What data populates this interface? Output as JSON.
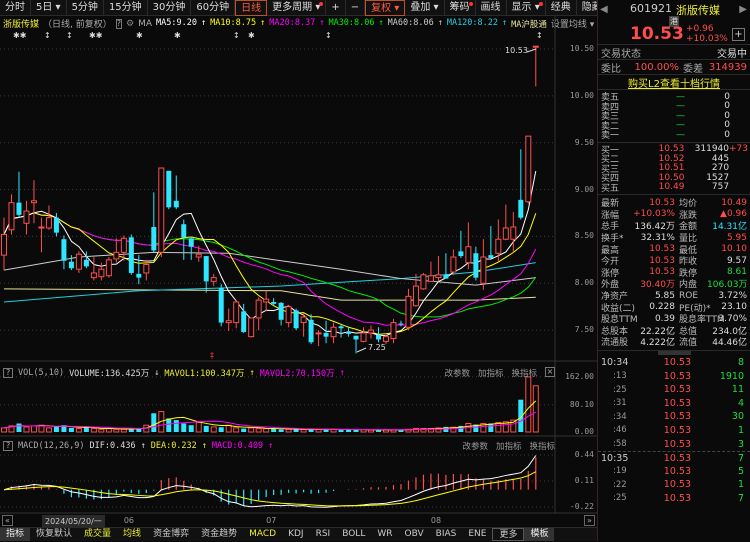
{
  "toolbar": {
    "items": [
      {
        "label": "分时"
      },
      {
        "label": "5日 ▾"
      },
      {
        "label": "5分钟"
      },
      {
        "label": "15分钟"
      },
      {
        "label": "30分钟"
      },
      {
        "label": "60分钟"
      },
      {
        "label": "日线",
        "active": true
      },
      {
        "label": "更多周期 ▾",
        "dot": true
      },
      {
        "label": "+"
      },
      {
        "label": "−"
      },
      {
        "label": "复权 ▾",
        "active": true
      },
      {
        "label": "叠加 ▾"
      },
      {
        "label": "筹码",
        "dot": true
      },
      {
        "label": "画线"
      },
      {
        "label": "显示 ▾",
        "dot": true
      },
      {
        "label": "经典"
      },
      {
        "label": "隐藏 ▸▸"
      },
      {
        "label": "⛶"
      }
    ]
  },
  "main": {
    "stock_name": "浙版传媒",
    "mode": "（日线, 前复权）",
    "help": "?",
    "ma_label": "MA",
    "ma": [
      {
        "label": "MA5:9.20",
        "color": "#ffffff"
      },
      {
        "label": "MA10:8.75",
        "color": "#ffff00"
      },
      {
        "label": "MA20:8.37",
        "color": "#ff00ff"
      },
      {
        "label": "MA30:8.06",
        "color": "#00ee00"
      },
      {
        "label": "MA60:8.06",
        "color": "#cccccc"
      },
      {
        "label": "MA120:8.22",
        "color": "#22d0e0"
      },
      {
        "label": "MA沪股通",
        "color": "#e8e0a0"
      }
    ],
    "ma_arrow": "↑",
    "ma_settings": "设置均线 ▾",
    "high_marker": "10.53",
    "low_marker": "7.25"
  },
  "chart_data": {
    "type": "candlestick",
    "price_axis": {
      "ticks": [
        "10.50",
        "10.00",
        "9.50",
        "9.00",
        "8.50",
        "8.00",
        "7.50"
      ],
      "range": [
        7.2,
        10.6
      ]
    },
    "x_ticks": [
      "06",
      "07",
      "08"
    ],
    "cursor_date": "2024/05/20/一",
    "ohlc": [
      [
        8.3,
        8.7,
        8.14,
        8.52
      ],
      [
        8.57,
        8.95,
        8.52,
        8.86
      ],
      [
        8.86,
        9.19,
        8.7,
        8.73
      ],
      [
        8.64,
        8.88,
        8.52,
        8.77
      ],
      [
        8.86,
        9.1,
        8.64,
        8.88
      ],
      [
        8.59,
        8.7,
        8.33,
        8.6
      ],
      [
        8.59,
        8.83,
        8.57,
        8.7
      ],
      [
        8.7,
        8.75,
        8.5,
        8.54
      ],
      [
        8.47,
        8.51,
        8.15,
        8.24
      ],
      [
        8.23,
        8.3,
        8.14,
        8.16
      ],
      [
        8.15,
        8.34,
        8.11,
        8.31
      ],
      [
        8.25,
        8.34,
        8.16,
        8.18
      ],
      [
        8.06,
        8.28,
        8.03,
        8.11
      ],
      [
        8.07,
        8.22,
        8.03,
        8.15
      ],
      [
        8.08,
        8.28,
        8.06,
        8.25
      ],
      [
        8.26,
        8.48,
        8.22,
        8.33
      ],
      [
        8.33,
        8.51,
        8.24,
        8.48
      ],
      [
        8.49,
        8.52,
        8.09,
        8.11
      ],
      [
        8.1,
        8.3,
        7.99,
        8.06
      ],
      [
        8.11,
        8.25,
        8.03,
        8.2
      ],
      [
        8.6,
        8.97,
        8.33,
        8.35
      ],
      [
        8.33,
        9.23,
        8.28,
        9.23
      ],
      [
        9.2,
        9.2,
        8.79,
        8.81
      ],
      [
        8.88,
        9.15,
        8.79,
        8.81
      ],
      [
        8.63,
        8.68,
        8.25,
        8.49
      ],
      [
        8.48,
        8.5,
        8.25,
        8.39
      ],
      [
        8.28,
        8.4,
        8.23,
        8.31
      ],
      [
        8.29,
        8.29,
        7.9,
        8.02
      ],
      [
        8.02,
        8.1,
        7.97,
        8.06
      ],
      [
        7.95,
        7.99,
        7.54,
        7.58
      ],
      [
        7.58,
        7.73,
        7.49,
        7.6
      ],
      [
        7.58,
        7.82,
        7.52,
        7.8
      ],
      [
        7.7,
        7.78,
        7.47,
        7.48
      ],
      [
        7.43,
        7.63,
        7.42,
        7.63
      ],
      [
        7.63,
        7.85,
        7.5,
        7.82
      ],
      [
        7.8,
        7.92,
        7.7,
        7.83
      ],
      [
        7.8,
        7.84,
        7.76,
        7.78
      ],
      [
        7.79,
        7.8,
        7.55,
        7.61
      ],
      [
        7.58,
        7.77,
        7.53,
        7.75
      ],
      [
        7.71,
        7.73,
        7.5,
        7.52
      ],
      [
        7.58,
        7.68,
        7.43,
        7.64
      ],
      [
        7.61,
        7.67,
        7.35,
        7.37
      ],
      [
        7.46,
        7.5,
        7.33,
        7.47
      ],
      [
        7.47,
        7.6,
        7.36,
        7.43
      ],
      [
        7.43,
        7.58,
        7.36,
        7.53
      ],
      [
        7.54,
        7.56,
        7.42,
        7.52
      ],
      [
        7.48,
        7.54,
        7.43,
        7.46
      ],
      [
        7.44,
        7.44,
        7.25,
        7.4
      ],
      [
        7.38,
        7.53,
        7.37,
        7.47
      ],
      [
        7.47,
        7.55,
        7.41,
        7.5
      ],
      [
        7.45,
        7.53,
        7.37,
        7.4
      ],
      [
        7.38,
        7.45,
        7.35,
        7.43
      ],
      [
        7.41,
        7.62,
        7.36,
        7.58
      ],
      [
        7.57,
        7.6,
        7.54,
        7.56
      ],
      [
        7.53,
        7.94,
        7.5,
        7.86
      ],
      [
        7.76,
        8.1,
        7.75,
        7.97
      ],
      [
        7.94,
        8.11,
        7.93,
        8.09
      ],
      [
        8.02,
        8.23,
        8.02,
        8.08
      ],
      [
        8.06,
        8.29,
        8.02,
        8.09
      ],
      [
        8.09,
        8.32,
        8.05,
        8.05
      ],
      [
        8.12,
        8.36,
        8.09,
        8.28
      ],
      [
        8.34,
        8.56,
        8.27,
        8.29
      ],
      [
        8.22,
        8.65,
        8.15,
        8.39
      ],
      [
        8.32,
        8.39,
        8.03,
        8.06
      ],
      [
        8.0,
        8.47,
        7.93,
        8.28
      ],
      [
        8.3,
        8.61,
        8.26,
        8.27
      ],
      [
        8.32,
        8.68,
        8.23,
        8.47
      ],
      [
        8.47,
        8.84,
        8.46,
        8.59
      ],
      [
        8.47,
        8.76,
        8.33,
        8.6
      ],
      [
        8.89,
        9.43,
        8.68,
        8.7
      ],
      [
        8.87,
        9.57,
        8.85,
        9.57
      ],
      [
        10.53,
        10.53,
        10.1,
        10.53
      ]
    ],
    "ma60_points": [
      [
        0,
        8.14
      ],
      [
        10,
        8.28
      ],
      [
        20,
        8.33
      ],
      [
        30,
        8.32
      ],
      [
        37,
        8.24
      ],
      [
        45,
        8.15
      ],
      [
        53,
        8.05
      ],
      [
        63,
        7.98
      ],
      [
        71,
        8.06
      ]
    ],
    "ma120_points": [
      [
        0,
        7.8
      ],
      [
        18,
        7.92
      ],
      [
        37,
        7.97
      ],
      [
        53,
        8.05
      ],
      [
        63,
        8.12
      ],
      [
        71,
        8.22
      ]
    ],
    "hgt_points": [
      [
        0,
        7.94
      ],
      [
        37,
        7.92
      ],
      [
        45,
        7.82
      ],
      [
        63,
        7.82
      ],
      [
        71,
        7.85
      ]
    ],
    "volume": [
      12,
      18,
      25,
      15,
      18,
      20,
      12,
      15,
      20,
      12,
      10,
      14,
      10,
      8,
      10,
      8,
      8,
      10,
      12,
      20,
      55,
      60,
      40,
      35,
      25,
      20,
      28,
      18,
      15,
      14,
      20,
      12,
      10,
      12,
      10,
      10,
      10,
      8,
      8,
      8,
      7,
      8,
      8,
      7,
      8,
      7,
      7,
      6,
      7,
      6,
      6,
      7,
      6,
      7,
      8,
      10,
      10,
      10,
      12,
      15,
      14,
      18,
      25,
      22,
      25,
      25,
      28,
      30,
      35,
      95,
      162,
      136
    ],
    "volume_axis": {
      "ticks": [
        "162.00",
        "80.10",
        "0.00"
      ],
      "range": [
        0,
        162
      ]
    },
    "macd_axis": {
      "ticks": [
        "0.44",
        "0.11",
        "-0.22"
      ]
    }
  },
  "vol_panel": {
    "help": "?",
    "name": "VOL(5,10)",
    "volume": "VOLUME:136.425万",
    "volume_arrow": "↓",
    "mavol1": "MAVOL1:100.347万",
    "mavol1_arrow": "↑",
    "mavol2": "MAVOL2:70.150万",
    "mavol2_arrow": "↑",
    "actions": [
      "改参数",
      "加指标",
      "换指标"
    ],
    "close": "×"
  },
  "macd_panel": {
    "help": "?",
    "name": "MACD(12,26,9)",
    "dif": "DIF:0.436",
    "dif_arrow": "↑",
    "dea": "DEA:0.232",
    "dea_arrow": "↑",
    "macd": "MACD:0.409",
    "macd_arrow": "↑",
    "actions": [
      "改参数",
      "加指标",
      "换指标"
    ]
  },
  "date_axis": {
    "prev": "«",
    "next": "»"
  },
  "bottom_tabs": [
    {
      "label": "指标",
      "cls": "act"
    },
    {
      "label": "恢复默认"
    },
    {
      "label": "成交量",
      "cls": "y"
    },
    {
      "label": "均线",
      "cls": "y"
    },
    {
      "label": "资金博弈"
    },
    {
      "label": "资金趋势"
    },
    {
      "label": "MACD",
      "cls": "y"
    },
    {
      "label": "KDJ"
    },
    {
      "label": "RSI"
    },
    {
      "label": "BOLL"
    },
    {
      "label": "WR"
    },
    {
      "label": "OBV"
    },
    {
      "label": "BIAS"
    },
    {
      "label": "ENE"
    },
    {
      "label": "更多",
      "cls": "bord"
    },
    {
      "label": "模板",
      "cls": "act"
    }
  ],
  "quote": {
    "code": "601921",
    "name": "浙版传媒",
    "badge": "港",
    "price": "10.53",
    "change": "+0.96",
    "change_pct": "+10.03%",
    "add": "+",
    "status_label": "交易状态",
    "status": "交易中",
    "wb_label": "委比",
    "wb": "100.00%",
    "wc_label": "委差",
    "wc": "314939",
    "l2_link": "购买L2查看十档行情",
    "asks": [
      {
        "label": "卖五",
        "price": "—",
        "vol": "0"
      },
      {
        "label": "卖四",
        "price": "—",
        "vol": "0"
      },
      {
        "label": "卖三",
        "price": "—",
        "vol": "0"
      },
      {
        "label": "卖二",
        "price": "—",
        "vol": "0"
      },
      {
        "label": "卖一",
        "price": "—",
        "vol": "0"
      }
    ],
    "bids": [
      {
        "label": "买一",
        "price": "10.53",
        "vol": "311940",
        "chg": "+73"
      },
      {
        "label": "买二",
        "price": "10.52",
        "vol": "445",
        "chg": ""
      },
      {
        "label": "买三",
        "price": "10.51",
        "vol": "270",
        "chg": ""
      },
      {
        "label": "买四",
        "price": "10.50",
        "vol": "1527",
        "chg": ""
      },
      {
        "label": "买五",
        "price": "10.49",
        "vol": "757",
        "chg": ""
      }
    ],
    "stats": [
      {
        "l": "最新",
        "v": "10.53",
        "c": "red",
        "l2": "均价",
        "v2": "10.49",
        "c2": "red"
      },
      {
        "l": "涨幅",
        "v": "+10.03%",
        "c": "red",
        "l2": "涨跌",
        "v2": "▲0.96",
        "c2": "red"
      },
      {
        "l": "总手",
        "v": "136.42万",
        "c": "wht",
        "l2": "金额",
        "v2": "14.31亿",
        "c2": "cyn"
      },
      {
        "l": "换手*",
        "v": "32.31%",
        "c": "wht",
        "l2": "量比",
        "v2": "5.95",
        "c2": "red"
      },
      {
        "l": "最高",
        "v": "10.53",
        "c": "red",
        "l2": "最低",
        "v2": "10.10",
        "c2": "red"
      },
      {
        "l": "今开",
        "v": "10.53",
        "c": "red",
        "l2": "昨收",
        "v2": "9.57",
        "c2": "wht"
      },
      {
        "l": "涨停",
        "v": "10.53",
        "c": "red",
        "l2": "跌停",
        "v2": "8.61",
        "c2": "grn"
      },
      {
        "l": "外盘",
        "v": "30.40万",
        "c": "red",
        "l2": "内盘",
        "v2": "106.03万",
        "c2": "grn"
      },
      {
        "l": "净资产",
        "v": "5.85",
        "c": "wht",
        "l2": "ROE",
        "v2": "3.72%",
        "c2": "wht"
      },
      {
        "l": "收益(二)",
        "v": "0.228",
        "c": "wht",
        "l2": "PE(动)*",
        "v2": "23.10",
        "c2": "wht"
      },
      {
        "l": "股息TTM",
        "v": "0.39",
        "c": "wht",
        "l2": "股息率TTM",
        "v2": "3.70%",
        "c2": "wht"
      },
      {
        "l": "总股本",
        "v": "22.22亿",
        "c": "wht",
        "l2": "总值",
        "v2": "234.0亿",
        "c2": "wht"
      },
      {
        "l": "流通股",
        "v": "4.222亿",
        "c": "wht",
        "l2": "流值",
        "v2": "44.46亿",
        "c2": "wht"
      }
    ],
    "ticks": [
      {
        "t": "10:34",
        "p": "10.53",
        "v": "8"
      },
      {
        "t": ":13",
        "p": "10.53",
        "v": "1910"
      },
      {
        "t": ":25",
        "p": "10.53",
        "v": "11"
      },
      {
        "t": ":31",
        "p": "10.53",
        "v": "4"
      },
      {
        "t": ":34",
        "p": "10.53",
        "v": "30"
      },
      {
        "t": ":46",
        "p": "10.53",
        "v": "1"
      },
      {
        "t": ":58",
        "p": "10.53",
        "v": "3"
      },
      {
        "t": "10:35",
        "p": "10.53",
        "v": "7"
      },
      {
        "t": ":19",
        "p": "10.53",
        "v": "5"
      },
      {
        "t": ":22",
        "p": "10.53",
        "v": "1"
      },
      {
        "t": ":25",
        "p": "10.53",
        "v": "7"
      }
    ]
  }
}
